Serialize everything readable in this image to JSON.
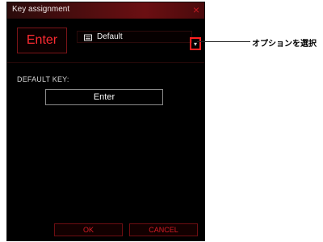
{
  "dialog": {
    "title": "Key assignment",
    "close_label": "×",
    "current_key": "Enter",
    "mode_dropdown": {
      "selected": "Default",
      "icon": "keyboard-icon"
    },
    "default_key_label": "DEFAULT KEY:",
    "default_key_value": "Enter",
    "ok_label": "OK",
    "cancel_label": "CANCEL"
  },
  "annotation": {
    "text": "オプションを選択"
  },
  "colors": {
    "accent_red": "#d81d26",
    "title_gradient_mid": "#6b0f12",
    "highlight_border": "#ff2020"
  }
}
